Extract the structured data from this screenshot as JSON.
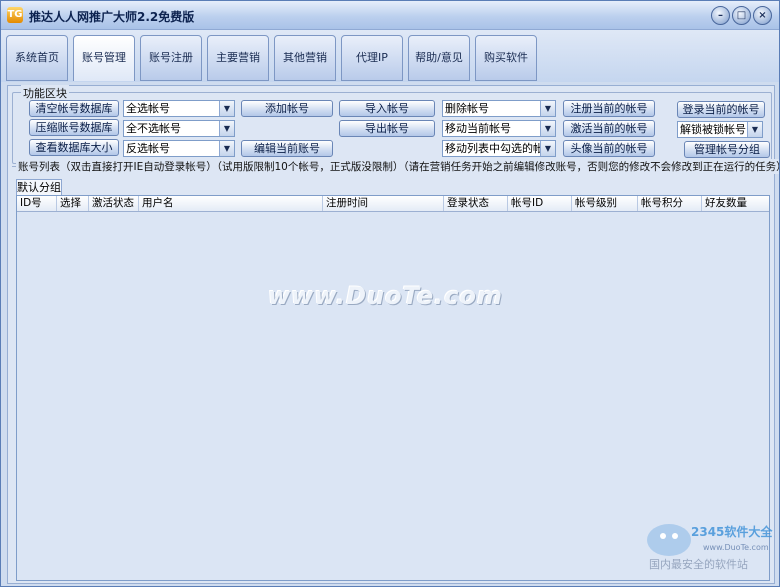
{
  "app": {
    "icon_text": "TG",
    "title": "推达人人网推广大师2.2免费版"
  },
  "window_controls": {
    "minimize": "–",
    "maximize": "□",
    "close": "×"
  },
  "tabs": [
    {
      "label": "系统首页"
    },
    {
      "label": "账号管理"
    },
    {
      "label": "账号注册"
    },
    {
      "label": "主要营销"
    },
    {
      "label": "其他营销"
    },
    {
      "label": "代理IP"
    },
    {
      "label": "帮助/意见"
    },
    {
      "label": "购买软件"
    }
  ],
  "function_area": {
    "legend": "功能区块",
    "buttons": {
      "clear_db": "清空帐号数据库",
      "compress_db": "压缩账号数据库",
      "db_size": "查看数据库大小",
      "add_account": "添加帐号",
      "edit_account": "编辑当前账号",
      "import": "导入帐号",
      "export": "导出帐号",
      "register_current": "注册当前的帐号",
      "activate_current": "激活当前的帐号",
      "avatar_current": "头像当前的帐号",
      "login_current": "登录当前的帐号",
      "manage_groups": "管理帐号分组"
    },
    "selects": {
      "select_all": "全选帐号",
      "select_none": "全不选帐号",
      "invert": "反选帐号",
      "delete": "删除帐号",
      "move_current": "移动当前帐号",
      "move_checked": "移动列表中勾选的帐",
      "unlock": "解锁被锁帐号"
    },
    "arrow": "▼"
  },
  "account_list": {
    "notice": "账号列表（双击直接打开IE自动登录帐号）（试用版限制10个帐号，正式版没限制）（请在营销任务开始之前编辑修改账号，否则您的修改不会修改到正在运行的任务）",
    "group_tab": "默认分组",
    "columns": [
      "ID号",
      "选择",
      "激活状态",
      "用户名",
      "注册时间",
      "登录状态",
      "帐号ID",
      "帐号级别",
      "帐号积分",
      "好友数量"
    ]
  },
  "watermarks": {
    "center": "www.DuoTe.com",
    "corner_brand": "2345软件大全",
    "corner_site": "www.DuoTe.com",
    "corner_slogan": "国内最安全的软件站"
  }
}
